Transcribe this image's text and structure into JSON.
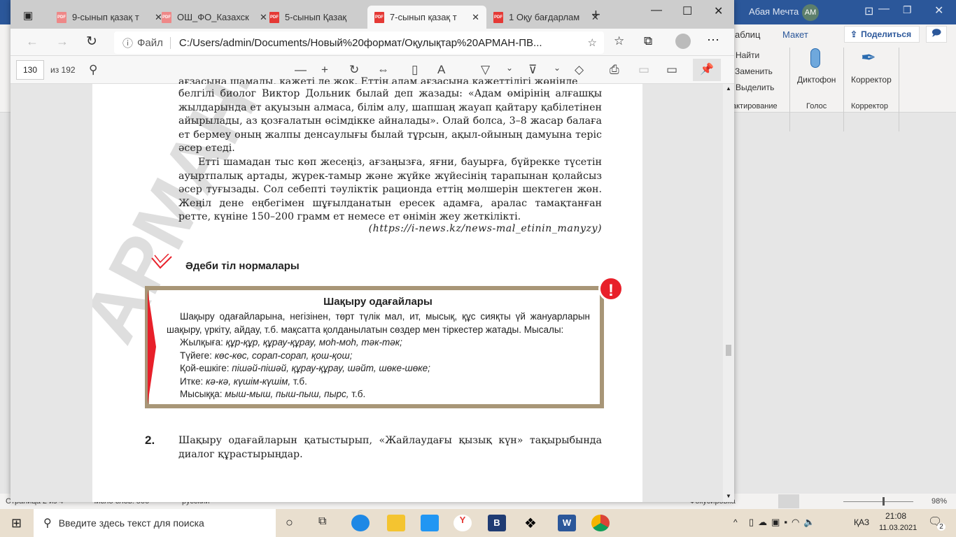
{
  "word": {
    "user": "Абая Мечта",
    "initials": "АМ",
    "tabs": [
      "аблиц",
      "Макет"
    ],
    "share": "Поделиться",
    "find": "Найти",
    "replace": "Заменить",
    "select": "Выделить",
    "group_edit": "актирование",
    "dictate": "Диктофон",
    "group_voice": "Голос",
    "corrector": "Корректор",
    "group_corrector": "Корректор",
    "status_page": "Страница 2 из 4",
    "status_words": "Число слов: 566",
    "status_lang": "русский",
    "status_focus": "Фокусировка",
    "zoom": "98%"
  },
  "edge": {
    "tabs": [
      {
        "label": "9-сынып қазақ т"
      },
      {
        "label": "ОШ_ФО_Казахск"
      },
      {
        "label": "5-сынып Қазақ"
      },
      {
        "label": "7-сынып қазақ т"
      },
      {
        "label": "1 Оқу бағдарлам"
      }
    ],
    "file_label": "Файл",
    "url": "C:/Users/admin/Documents/Новый%20формат/Оқулықтар%20АРМАН-ПВ...",
    "page_current": "130",
    "page_total": "из 192"
  },
  "doc": {
    "top_partial": "ағзасына шамалы, қажеті де жоқ. Еттің адам ағзасына қажеттілігі жөнінде",
    "p1": "белгілі биолог Виктор Дольник былай деп жазады: «Адам өмірінің алғашқы жылдарында ет ақуызын алмаса, білім алу, шапшаң жауап қайтару қабілетінен айырылады, аз қозғалатын өсімдікке айналады». Олай болса, 3–8 жасар балаға ет бермеу оның жалпы денсаулығы былай тұрсын, ақыл-ойының дамуына теріс әсер етеді.",
    "p2": "Етті шамадан тыс көп жесеңіз, ағзаңызға, яғни, бауырға, бүйрекке түсетін ауыртпалық артады, жүрек-тамыр және жүйке жүйесінің тарапынан қолайсыз әсер туғызады. Сол себепті тәуліктік рационда еттің мөлшерін шектеген жөн. Жеңіл дене еңбегімен шұғылданатын ересек адамға, аралас тамақтанған ретте, күніне 150–200 грамм ет немесе ет өнімін жеу жеткілікті.",
    "source": "(https://i-news.kz/news-mal_etinin_manyzy)",
    "section": "Әдеби тіл нормалары",
    "box_title": "Шақыру одағайлары",
    "box_intro": "Шақыру одағайларына, негізінен, төрт түлік мал, ит, мысық, құс сияқты үй жануарларын шақыру, үркіту, айдау, т.б. мақсатта қолданылатын сөздер мен тіркестер жатады. Мысалы:",
    "examples": [
      {
        "k": "Жылқыға: ",
        "v": "құр-құр, құрау-құрау, моһ-моһ, тәк-тәк;",
        "t": ""
      },
      {
        "k": "Түйеге: ",
        "v": "көс-көс, сорап-сорап, қош-қош;",
        "t": ""
      },
      {
        "k": "Қой-ешкіге: ",
        "v": "пішәй-пішәй, құрау-құрау, шәйт, шөке-шөке;",
        "t": ""
      },
      {
        "k": "Итке: ",
        "v": "кә-кә, күшім-күшім,",
        "t": " т.б."
      },
      {
        "k": "Мысыққа: ",
        "v": "мыш-мыш, пыш-пыш, пырс,",
        "t": " т.б."
      }
    ],
    "task_num": "2.",
    "task": "Шақыру одағайларын қатыстырып, «Жайлаудағы қызық күн» тақырыбында диалог құрастырыңдар.",
    "watermark": "АРМАН-ПВ ба"
  },
  "taskbar": {
    "search": "Введите здесь текст для поиска",
    "lang": "ҚАЗ",
    "time": "21:08",
    "date": "11.03.2021",
    "notif": "2"
  },
  "colors": {
    "word_blue": "#2b579a",
    "box_border": "#a89677",
    "accent_red": "#e8202a"
  }
}
